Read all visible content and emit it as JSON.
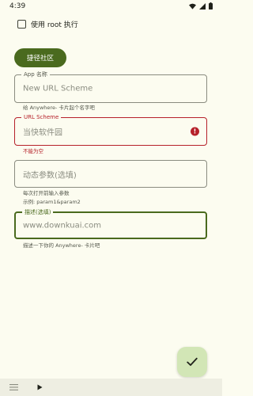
{
  "status": {
    "time": "4:39"
  },
  "checkbox": {
    "label": "使用 root 执行",
    "checked": false
  },
  "community_button": {
    "label": "捷径社区"
  },
  "fields": [
    {
      "label": "App 名称",
      "value": "New URL Scheme",
      "helper": "给 Anywhere- 卡片起个名字吧"
    },
    {
      "label": "URL Scheme",
      "value": "当快软件园",
      "helper": "不能为空",
      "state": "error"
    },
    {
      "label": "",
      "value": "动态参数(选填)",
      "helper": "每次打开前输入参数",
      "helper2": "示例: param1&param2"
    },
    {
      "label": "描述(选填)",
      "value": "www.downkuai.com",
      "helper": "描述一下你的 Anywhere- 卡片吧",
      "state": "focused"
    }
  ],
  "colors": {
    "primary": "#4a6a1e",
    "error": "#b6212a",
    "background": "#fcfcf0",
    "fab": "#d2e6b6"
  },
  "icons": {
    "fab": "check-icon",
    "menu": "menu-icon",
    "run": "play-icon"
  }
}
